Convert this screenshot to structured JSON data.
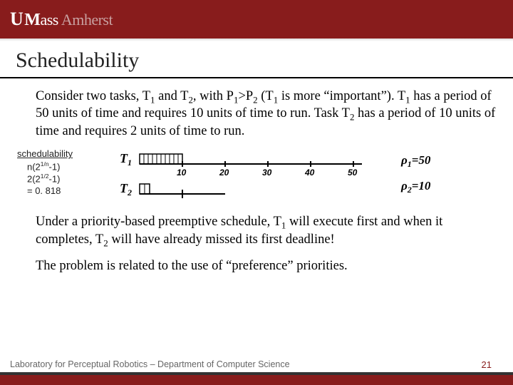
{
  "header": {
    "brand_u": "U",
    "brand_m": "M",
    "brand_ass": "ass",
    "brand_amherst": "Amherst"
  },
  "title": "Schedulability",
  "paragraphs": {
    "p1a": "Consider two tasks, T",
    "p1b": " and T",
    "p1c": ", with P",
    "p1d": ">P",
    "p1e": " (T",
    "p1f": " is more “important”). T",
    "p1g": " has a period of 50 units of time and requires 10 units of time to run. Task T",
    "p1h": " has a period of 10 units of time and requires 2 units of time to run.",
    "p2a": "Under a priority-based preemptive schedule, T",
    "p2b": " will execute first and when it completes, T",
    "p2c": " will have already missed its first deadline!",
    "p3": "The problem is related to the use of “preference” priorities."
  },
  "sched": {
    "label": "schedulability",
    "line1a": "n(2",
    "line1b": "-1)",
    "line2a": "2(2",
    "line2b": "-1)",
    "line3": "= 0. 818",
    "exp1": "1/n",
    "exp2": "1/2"
  },
  "diagram": {
    "t1_label": "T",
    "t2_label": "T",
    "sub1": "1",
    "sub2": "2",
    "ticks": [
      "10",
      "20",
      "30",
      "40",
      "50"
    ],
    "rho1a": "ρ",
    "rho1b": "=50",
    "rho2a": "ρ",
    "rho2b": "=10"
  },
  "footer": {
    "text": "Laboratory for Perceptual Robotics – Department of Computer Science",
    "page": "21"
  }
}
